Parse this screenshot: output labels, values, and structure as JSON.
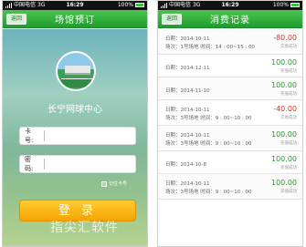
{
  "status": {
    "carrier": "中国电信",
    "network": "3G",
    "time": "16:29",
    "battery": "100%"
  },
  "login_screen": {
    "back_label": "返回",
    "title": "场馆预订",
    "venue_name": "长宁网球中心",
    "card_label": "卡 号:",
    "password_label": "密 码:",
    "card_value": "",
    "password_value": "",
    "remember_label": "记住卡号",
    "login_button": "登 录",
    "watermark": "指尖汇软件"
  },
  "records_screen": {
    "back_label": "返回",
    "title": "消费记录",
    "records": [
      {
        "date": "日期：2014-10-11",
        "detail": "场次：1号场地    时间：14 : 00~15 : 00",
        "amount": "-80.00",
        "status": "交易成功",
        "type": "neg"
      },
      {
        "date": "日期：2014-12-11",
        "detail": "",
        "amount": "100.00",
        "status": "充值成功",
        "type": "pos"
      },
      {
        "date": "日期：2014-11-10",
        "detail": "",
        "amount": "100.00",
        "status": "充值成功",
        "type": "pos"
      },
      {
        "date": "日期：2014-10-11",
        "detail": "场次：3号场地    时间：9 : 00~10 : 00",
        "amount": "-40.00",
        "status": "交易成功",
        "type": "neg"
      },
      {
        "date": "日期：2014-10-11",
        "detail": "场次：3号场地    时间：9 : 00~10 : 00",
        "amount": "100.00",
        "status": "充值成功",
        "type": "pos"
      },
      {
        "date": "日期：2014-10-8",
        "detail": "",
        "amount": "100.00",
        "status": "充值成功",
        "type": "pos"
      },
      {
        "date": "日期：2014-10-11",
        "detail": "场次：3号场地    时间：9 : 00~10 : 00",
        "amount": "100.00",
        "status": "充值成功",
        "type": "pos"
      }
    ]
  },
  "colors": {
    "header_green": "#2ea83a",
    "login_orange": "#f5a300",
    "positive": "#2a9a2a",
    "negative": "#d93a2b"
  }
}
